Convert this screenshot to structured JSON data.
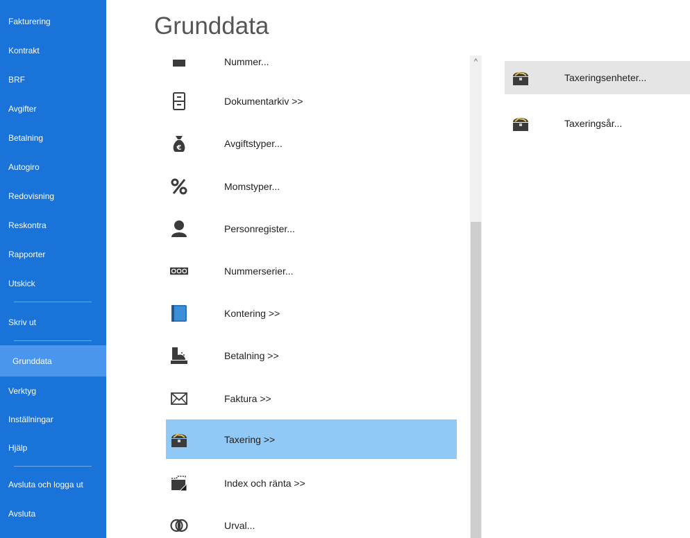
{
  "sidebar": {
    "items": [
      {
        "label": "Fakturering"
      },
      {
        "label": "Kontrakt"
      },
      {
        "label": "BRF"
      },
      {
        "label": "Avgifter"
      },
      {
        "label": "Betalning"
      },
      {
        "label": "Autogiro"
      },
      {
        "label": "Redovisning"
      },
      {
        "label": "Reskontra"
      },
      {
        "label": "Rapporter"
      },
      {
        "label": "Utskick"
      },
      {
        "label": "Skriv ut"
      },
      {
        "label": "Grunddata"
      },
      {
        "label": "Verktyg"
      },
      {
        "label": "Inställningar"
      },
      {
        "label": "Hjälp"
      },
      {
        "label": "Avsluta och logga ut"
      },
      {
        "label": "Avsluta"
      }
    ],
    "active": "Grunddata"
  },
  "page": {
    "title": "Grunddata"
  },
  "menu": {
    "items": [
      {
        "label": "Nummer...",
        "icon": "square-icon"
      },
      {
        "label": "Dokumentarkiv >>",
        "icon": "file-cabinet-icon"
      },
      {
        "label": "Avgiftstyper...",
        "icon": "money-bag-icon"
      },
      {
        "label": "Momstyper...",
        "icon": "percent-icon"
      },
      {
        "label": "Personregister...",
        "icon": "person-icon"
      },
      {
        "label": "Nummerserier...",
        "icon": "number-counter-icon"
      },
      {
        "label": "Kontering >>",
        "icon": "book-icon"
      },
      {
        "label": "Betalning >>",
        "icon": "cash-register-icon"
      },
      {
        "label": "Faktura >>",
        "icon": "envelope-icon"
      },
      {
        "label": "Taxering >>",
        "icon": "treasure-chest-icon"
      },
      {
        "label": "Index och ränta >>",
        "icon": "folder-chart-icon"
      },
      {
        "label": "Urval...",
        "icon": "venn-circles-icon"
      }
    ],
    "selected": "Taxering >>"
  },
  "submenu": {
    "items": [
      {
        "label": "Taxeringsenheter...",
        "icon": "treasure-chest-icon"
      },
      {
        "label": "Taxeringsår...",
        "icon": "treasure-chest-icon"
      }
    ],
    "hovered": "Taxeringsenheter..."
  },
  "scrollbar": {
    "up_arrow": "^"
  }
}
